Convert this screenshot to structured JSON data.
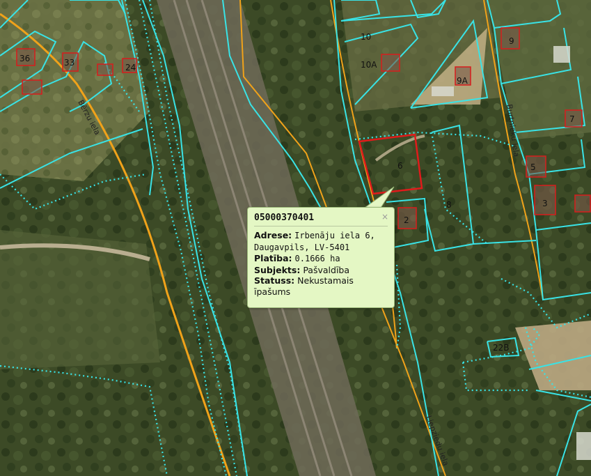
{
  "map": {
    "parcel_labels": [
      "36",
      "33",
      "24",
      "10",
      "10A",
      "9",
      "9A",
      "7",
      "6",
      "8",
      "5",
      "3",
      "2",
      "22B"
    ],
    "street_labels": [
      "Bērzu iela",
      "Burtnieku iela",
      "Liepziedu iela"
    ],
    "colors": {
      "parcel_border": "#39e3e6",
      "selected_parcel": "#e01b1b",
      "road_line": "#f0a21a",
      "building_outline": "#d81c1c"
    }
  },
  "popup": {
    "title": "05000370401",
    "close_icon": "×",
    "rows": [
      {
        "label": "Adrese:",
        "value": "Irbenāju iela 6, Daugavpils, LV-5401"
      },
      {
        "label": "Platība:",
        "value": "0.1666 ha"
      },
      {
        "label": "Subjekts:",
        "value": "Pašvaldība"
      },
      {
        "label": "Statuss:",
        "value": "Nekustamais īpašums"
      }
    ]
  }
}
